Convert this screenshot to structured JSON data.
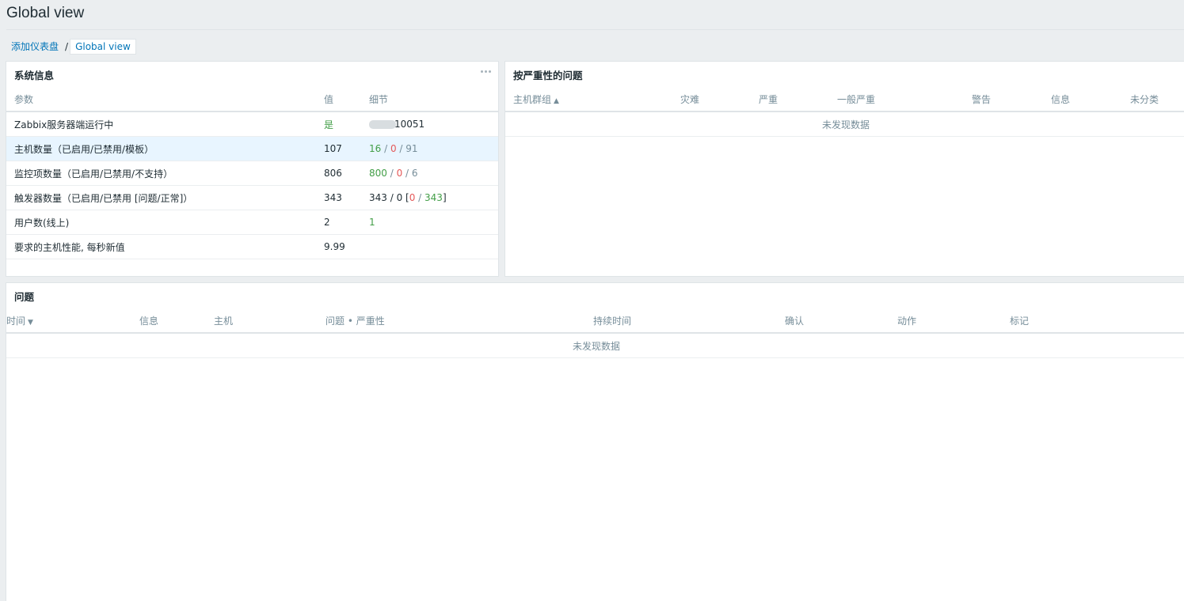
{
  "page": {
    "title": "Global view"
  },
  "breadcrumb": {
    "parent": "添加仪表盘",
    "separator": "/",
    "current": "Global view"
  },
  "system_info": {
    "title": "系统信息",
    "headers": {
      "param": "参数",
      "value": "值",
      "details": "细节"
    },
    "rows": [
      {
        "param": "Zabbix服务器端运行中",
        "value": "是",
        "details_suffix": "10051"
      },
      {
        "param": "主机数量（已启用/已禁用/模板）",
        "value": "107",
        "d1": "16",
        "s1": " / ",
        "d2": "0",
        "s2": " / ",
        "d3": "91"
      },
      {
        "param": "监控项数量（已启用/已禁用/不支持）",
        "value": "806",
        "d1": "800",
        "s1": " / ",
        "d2": "0",
        "s2": " / ",
        "d3": "6"
      },
      {
        "param": "触发器数量（已启用/已禁用 [问题/正常]）",
        "value": "343",
        "d_pre": "343 / 0 [",
        "d1": "0",
        "s1": " / ",
        "d2": "343",
        "d_post": "]"
      },
      {
        "param": "用户数(线上)",
        "value": "2",
        "d1": "1"
      },
      {
        "param": "要求的主机性能, 每秒新值",
        "value": "9.99"
      }
    ]
  },
  "problems_by_severity": {
    "title": "按严重性的问题",
    "headers": {
      "host_group": "主机群组",
      "disaster": "灾难",
      "high": "严重",
      "average": "一般严重",
      "warning": "警告",
      "info": "信息",
      "not_classified": "未分类"
    },
    "no_data": "未发现数据"
  },
  "problems": {
    "title": "问题",
    "headers": {
      "time": "时间",
      "info": "信息",
      "host": "主机",
      "problem_severity": "问题 • 严重性",
      "duration": "持续时间",
      "ack": "确认",
      "actions": "动作",
      "tags": "标记"
    },
    "no_data": "未发现数据"
  },
  "colors": {
    "ok": "#429e47",
    "problem": "#e45959",
    "link": "#0275b8",
    "highlight": "#e8f5ff"
  },
  "icons": {
    "menu": "ellipsis-icon",
    "sort_asc": "sort-up-icon",
    "sort_desc": "sort-down-icon"
  }
}
